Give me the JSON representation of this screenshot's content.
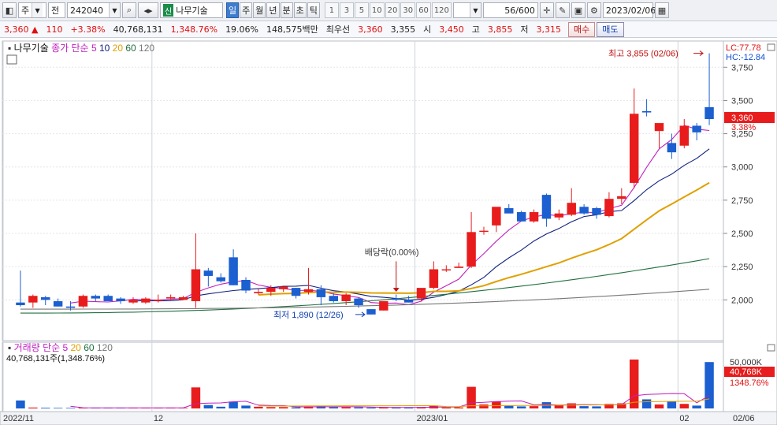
{
  "toolbar": {
    "market": "주",
    "type": "전",
    "code": "242040",
    "new_badge": "신",
    "stock_name": "나무기술",
    "periods": [
      "일",
      "주",
      "월",
      "년",
      "분",
      "초",
      "틱"
    ],
    "active_period": "일",
    "intervals": [
      "1",
      "3",
      "5",
      "10",
      "20",
      "30",
      "60",
      "120"
    ],
    "count": "56",
    "count_total": "/600",
    "date": "2023/02/06"
  },
  "info": {
    "price": "3,360",
    "arrow": "▲",
    "change": "110",
    "change_pct": "+3.38%",
    "volume": "40,768,131",
    "volume_pct": "1,348.76%",
    "turnover": "19.06%",
    "amount": "148,575백만",
    "best_label": "최우선",
    "best_ask": "3,360",
    "best_bid": "3,355",
    "open_label": "시",
    "open": "3,450",
    "high_label": "고",
    "high": "3,855",
    "low_label": "저",
    "low": "3,315",
    "buy": "매수",
    "sell": "매도"
  },
  "chart": {
    "stock_label": "나무기술",
    "legend_label": "종가 단순",
    "ma_periods": [
      "5",
      "10",
      "20",
      "60",
      "120"
    ],
    "ma_colors": [
      "#c020c0",
      "#102080",
      "#e0a000",
      "#207040",
      "#777777"
    ],
    "lc": "LC:77.78",
    "hc": "HC:-12.84",
    "price_axis": [
      "3,750",
      "3,500",
      "3,250",
      "3,000",
      "2,750",
      "2,500",
      "2,250",
      "2,000"
    ],
    "price_tag": "3,360",
    "price_tag_pct": "3.38%",
    "high_annotation": "최고 3,855 (02/06)",
    "low_annotation": "최저 1,890 (12/26)",
    "dividend_annotation": "배당락(0.00%)",
    "volume_label": "거래량",
    "volume_legend": "단순",
    "volume_ma_periods": [
      "5",
      "20",
      "60",
      "120"
    ],
    "volume_info": "40,768,131주(1,348.76%)",
    "volume_axis": [
      "50,000K",
      "40,768K",
      "1348.76%"
    ],
    "date_labels": [
      "2022/11",
      "12",
      "2023/01",
      "02",
      "02/06"
    ],
    "up_color": "#e81c1c",
    "down_color": "#1b5fd0"
  },
  "chart_data": {
    "type": "candlestick",
    "ylim": [
      1800,
      3900
    ],
    "candles": [
      {
        "o": 1980,
        "h": 2220,
        "l": 1950,
        "c": 1960
      },
      {
        "o": 1980,
        "h": 2040,
        "l": 1940,
        "c": 2030
      },
      {
        "o": 2020,
        "h": 2030,
        "l": 1960,
        "c": 2000
      },
      {
        "o": 1990,
        "h": 2010,
        "l": 1950,
        "c": 1950
      },
      {
        "o": 1950,
        "h": 1990,
        "l": 1920,
        "c": 1940
      },
      {
        "o": 1950,
        "h": 2040,
        "l": 1940,
        "c": 2030
      },
      {
        "o": 2030,
        "h": 2040,
        "l": 1990,
        "c": 2010
      },
      {
        "o": 2030,
        "h": 2040,
        "l": 2000,
        "c": 1990
      },
      {
        "o": 2010,
        "h": 2020,
        "l": 1970,
        "c": 1990
      },
      {
        "o": 1980,
        "h": 2020,
        "l": 1970,
        "c": 2000
      },
      {
        "o": 1980,
        "h": 2020,
        "l": 1970,
        "c": 2010
      },
      {
        "o": 2000,
        "h": 2040,
        "l": 1980,
        "c": 2000
      },
      {
        "o": 2010,
        "h": 2040,
        "l": 2000,
        "c": 2020
      },
      {
        "o": 2000,
        "h": 2030,
        "l": 2000,
        "c": 2020
      },
      {
        "o": 1990,
        "h": 2500,
        "l": 1940,
        "c": 2230
      },
      {
        "o": 2220,
        "h": 2240,
        "l": 2100,
        "c": 2180
      },
      {
        "o": 2170,
        "h": 2200,
        "l": 2130,
        "c": 2140
      },
      {
        "o": 2320,
        "h": 2380,
        "l": 2110,
        "c": 2110
      },
      {
        "o": 2150,
        "h": 2170,
        "l": 2050,
        "c": 2070
      },
      {
        "o": 2050,
        "h": 2080,
        "l": 2040,
        "c": 2060
      },
      {
        "o": 2060,
        "h": 2110,
        "l": 2030,
        "c": 2090
      },
      {
        "o": 2080,
        "h": 2100,
        "l": 2060,
        "c": 2100
      },
      {
        "o": 2090,
        "h": 2090,
        "l": 2010,
        "c": 2030
      },
      {
        "o": 2060,
        "h": 2240,
        "l": 2040,
        "c": 2080
      },
      {
        "o": 2080,
        "h": 2110,
        "l": 1960,
        "c": 2020
      },
      {
        "o": 2030,
        "h": 2050,
        "l": 1980,
        "c": 1990
      },
      {
        "o": 1990,
        "h": 2050,
        "l": 1960,
        "c": 2040
      },
      {
        "o": 2010,
        "h": 2020,
        "l": 1940,
        "c": 1960
      },
      {
        "o": 1930,
        "h": 1930,
        "l": 1890,
        "c": 1890
      },
      {
        "o": 1920,
        "h": 1990,
        "l": 1920,
        "c": 1990
      },
      {
        "o": 2010,
        "h": 2040,
        "l": 1990,
        "c": 2000
      },
      {
        "o": 2000,
        "h": 2030,
        "l": 1980,
        "c": 1980
      },
      {
        "o": 2010,
        "h": 2080,
        "l": 1990,
        "c": 2090
      },
      {
        "o": 2090,
        "h": 2290,
        "l": 2080,
        "c": 2230
      },
      {
        "o": 2230,
        "h": 2260,
        "l": 2210,
        "c": 2230
      },
      {
        "o": 2240,
        "h": 2280,
        "l": 2240,
        "c": 2250
      },
      {
        "o": 2250,
        "h": 2660,
        "l": 2240,
        "c": 2510
      },
      {
        "o": 2520,
        "h": 2550,
        "l": 2490,
        "c": 2520
      },
      {
        "o": 2560,
        "h": 2690,
        "l": 2510,
        "c": 2700
      },
      {
        "o": 2690,
        "h": 2720,
        "l": 2670,
        "c": 2650
      },
      {
        "o": 2660,
        "h": 2670,
        "l": 2620,
        "c": 2590
      },
      {
        "o": 2590,
        "h": 2680,
        "l": 2580,
        "c": 2660
      },
      {
        "o": 2790,
        "h": 2800,
        "l": 2550,
        "c": 2610
      },
      {
        "o": 2620,
        "h": 2680,
        "l": 2600,
        "c": 2650
      },
      {
        "o": 2640,
        "h": 2840,
        "l": 2630,
        "c": 2730
      },
      {
        "o": 2700,
        "h": 2720,
        "l": 2640,
        "c": 2650
      },
      {
        "o": 2690,
        "h": 2700,
        "l": 2610,
        "c": 2640
      },
      {
        "o": 2630,
        "h": 2810,
        "l": 2620,
        "c": 2760
      },
      {
        "o": 2760,
        "h": 2840,
        "l": 2720,
        "c": 2780
      },
      {
        "o": 2880,
        "h": 3590,
        "l": 2840,
        "c": 3400
      },
      {
        "o": 3420,
        "h": 3510,
        "l": 3380,
        "c": 3410
      },
      {
        "o": 3270,
        "h": 3270,
        "l": 3140,
        "c": 3330
      },
      {
        "o": 3180,
        "h": 3250,
        "l": 3060,
        "c": 3110
      },
      {
        "o": 3160,
        "h": 3360,
        "l": 3140,
        "c": 3310
      },
      {
        "o": 3310,
        "h": 3330,
        "l": 3200,
        "c": 3260
      },
      {
        "o": 3450,
        "h": 3855,
        "l": 3315,
        "c": 3360
      }
    ],
    "volume_k": [
      7000,
      800,
      600,
      500,
      500,
      700,
      600,
      600,
      500,
      500,
      600,
      500,
      700,
      500,
      18500,
      3000,
      1500,
      6000,
      2500,
      1500,
      1200,
      1200,
      1000,
      1800,
      2000,
      1200,
      1200,
      1000,
      800,
      700,
      900,
      700,
      1200,
      2500,
      800,
      900,
      19000,
      3500,
      6000,
      2500,
      1800,
      2000,
      5500,
      3000,
      4500,
      2000,
      1800,
      4000,
      4500,
      43000,
      8000,
      3500,
      6500,
      4000,
      2500,
      40768
    ]
  }
}
